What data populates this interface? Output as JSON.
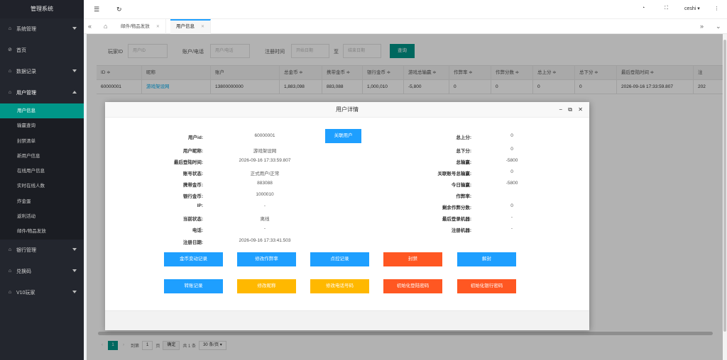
{
  "sidebar": {
    "brand": "管理系统",
    "groups": [
      {
        "label": "系统管理"
      },
      {
        "label": "首页"
      },
      {
        "label": "数据记录"
      },
      {
        "label": "用户管理"
      },
      {
        "label": "银行管理"
      },
      {
        "label": "兑换码"
      },
      {
        "label": "V10玩家"
      }
    ],
    "sub_items": [
      {
        "label": "用户信息"
      },
      {
        "label": "输赢查询"
      },
      {
        "label": "封禁清单"
      },
      {
        "label": "新用户信息"
      },
      {
        "label": "在线用户信息"
      },
      {
        "label": "实时在线人数"
      },
      {
        "label": "炸金蛋"
      },
      {
        "label": "返利活动"
      },
      {
        "label": "邮件/物品发放"
      }
    ]
  },
  "topbar": {
    "user": "ceshi"
  },
  "tabs": [
    {
      "label": "邮件/物品发放"
    },
    {
      "label": "用户信息"
    }
  ],
  "filter": {
    "player_id_label": "玩家ID",
    "player_id_placeholder": "用户ID",
    "account_label": "账户/电话",
    "account_placeholder": "用户/电话",
    "reg_time_label": "注册时间",
    "start_placeholder": "开始日期",
    "to_label": "至",
    "end_placeholder": "结束日期",
    "query_btn": "查询"
  },
  "table": {
    "headers": [
      "ID ≑",
      "昵称",
      "账户",
      "总金币 ≑",
      "携带金币 ≑",
      "银行金币 ≑",
      "游戏总输赢 ≑",
      "作弊率 ≑",
      "作弊分数 ≑",
      "总上分 ≑",
      "总下分 ≑",
      "最后登陆时间 ≑",
      "注"
    ],
    "rows": [
      [
        "60000001",
        "游戏架设网",
        "13800000000",
        "1,883,098",
        "883,088",
        "1,000,010",
        "-5,800",
        "0",
        "0",
        "0",
        "0",
        "2026-09-16 17:33:59.807",
        "202"
      ]
    ]
  },
  "pager": {
    "page": "1",
    "goto": "到第",
    "page_input": "1",
    "page_unit": "页",
    "confirm": "确定",
    "total": "共 1 条",
    "per_page": "30 条/页"
  },
  "modal": {
    "title": "用户详情",
    "left": [
      {
        "label": "用户id:",
        "value": "60000001"
      },
      {
        "label": "用户昵称:",
        "value": "游戏架设网"
      },
      {
        "label": "最后登陆时间:",
        "value": "2026-09-16 17:33:59.807"
      },
      {
        "label": "账号状态:",
        "value": "正式用户/正常"
      },
      {
        "label": "携带金币:",
        "value": "883088"
      },
      {
        "label": "银行金币:",
        "value": "1000010"
      },
      {
        "label": "IP:",
        "value": "-"
      },
      {
        "label": "当前状态:",
        "value": "离线"
      },
      {
        "label": "电话:",
        "value": "-"
      },
      {
        "label": "注册日期:",
        "value": "2026-09-16 17:33:41.503"
      }
    ],
    "right": [
      {
        "label": "总上分:",
        "value": "0"
      },
      {
        "label": "总下分:",
        "value": "0"
      },
      {
        "label": "总输赢:",
        "value": "-5800"
      },
      {
        "label": "关联账号总输赢:",
        "value": "0"
      },
      {
        "label": "今日输赢:",
        "value": "-5800"
      },
      {
        "label": "作弊率:",
        "value": ""
      },
      {
        "label": "剩余作弊分数:",
        "value": "0"
      },
      {
        "label": "最后登录机器:",
        "value": "-"
      },
      {
        "label": "注册机器:",
        "value": "-"
      }
    ],
    "link_user_btn": "关联用户",
    "buttons_row1": [
      {
        "label": "金币变动记录",
        "color": "#1e9fff"
      },
      {
        "label": "修改作弊率",
        "color": "#1e9fff"
      },
      {
        "label": "点控记录",
        "color": "#1e9fff"
      },
      {
        "label": "封禁",
        "color": "#ff5722"
      },
      {
        "label": "解封",
        "color": "#1e9fff"
      }
    ],
    "buttons_row2": [
      {
        "label": "转账记录",
        "color": "#1e9fff"
      },
      {
        "label": "修改昵称",
        "color": "#ffb800"
      },
      {
        "label": "修改电话号码",
        "color": "#ffb800"
      },
      {
        "label": "初始化登陆密码",
        "color": "#ff5722"
      },
      {
        "label": "初始化银行密码",
        "color": "#ff5722"
      }
    ]
  },
  "colors": {
    "accent": "#009688",
    "blue": "#1e9fff",
    "red": "#ff5722",
    "orange": "#ffb800"
  }
}
